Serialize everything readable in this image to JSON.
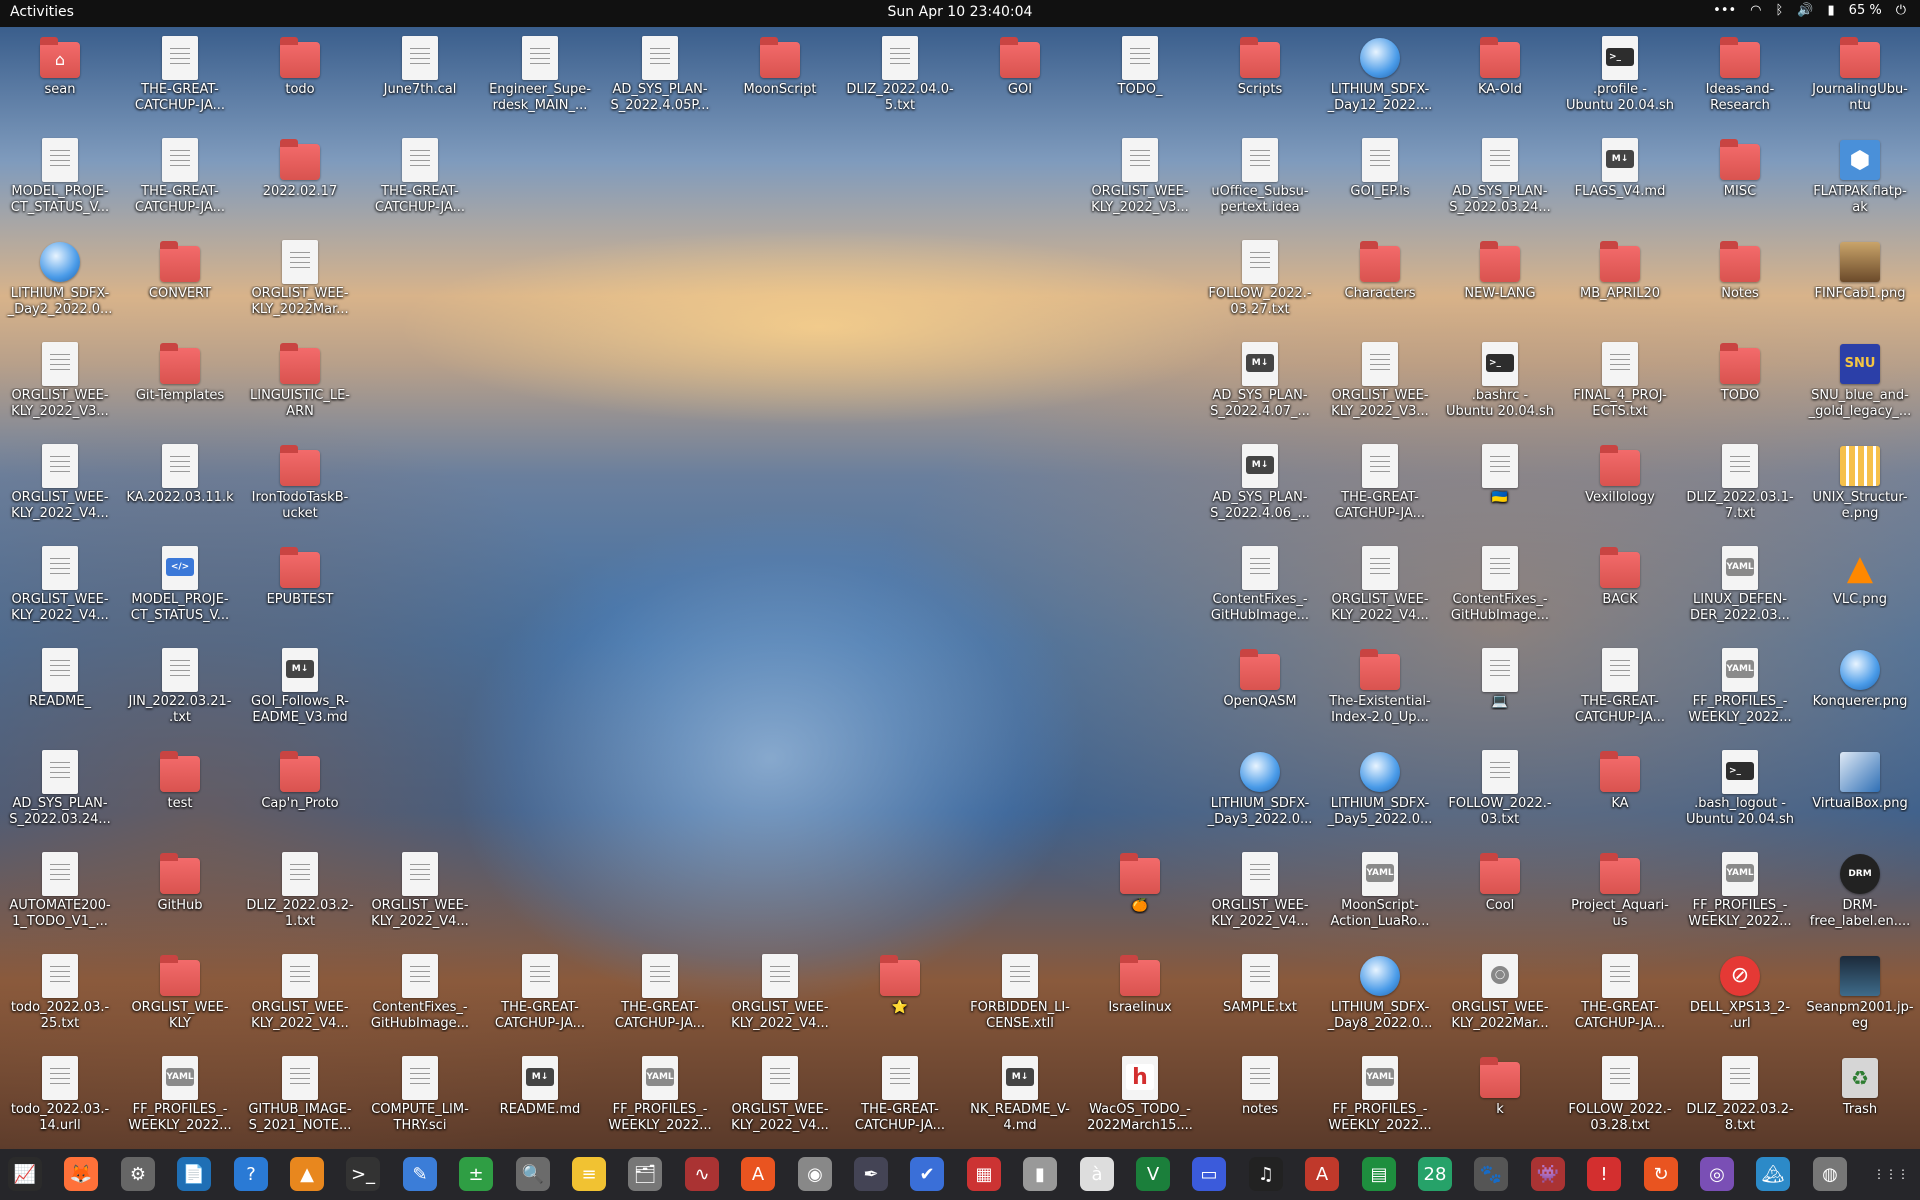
{
  "topbar": {
    "activities": "Activities",
    "clock": "Sun Apr 10  23:40:04",
    "battery": "65 %",
    "tray_icons": [
      "overflow-icon",
      "wifi-icon",
      "bluetooth-icon",
      "volume-icon",
      "battery-icon",
      "power-icon"
    ]
  },
  "desktop": {
    "icons": [
      {
        "label": "sean",
        "type": "home"
      },
      {
        "label": "THE-GREAT-\nCATCHUP-JA...",
        "type": "doc"
      },
      {
        "label": "todo",
        "type": "folder"
      },
      {
        "label": "June7th.cal",
        "type": "doc"
      },
      {
        "label": "Engineer_Supe-\nrdesk_MAIN_...",
        "type": "doc"
      },
      {
        "label": "AD_SYS_PLAN-\nS_2022.4.05P...",
        "type": "doc"
      },
      {
        "label": "MoonScript",
        "type": "folder"
      },
      {
        "label": "DLIZ_2022.04.0-\n5.txt",
        "type": "doc"
      },
      {
        "label": "GOI",
        "type": "folder"
      },
      {
        "label": "TODO_",
        "type": "doc"
      },
      {
        "label": "Scripts",
        "type": "folder"
      },
      {
        "label": "LITHIUM_SDFX-\n_Day12_2022....",
        "type": "orb"
      },
      {
        "label": "KA-Old",
        "type": "folder"
      },
      {
        "label": ".profile -\nUbuntu 20.04.sh",
        "type": "sh"
      },
      {
        "label": "Ideas-and-\nResearch",
        "type": "folder"
      },
      {
        "label": "JournalingUbu-\nntu",
        "type": "folder"
      },
      {
        "label": "MODEL_PROJE-\nCT_STATUS_V...",
        "type": "doc"
      },
      {
        "label": "THE-GREAT-\nCATCHUP-JA...",
        "type": "doc"
      },
      {
        "label": "2022.02.17",
        "type": "folder"
      },
      {
        "label": "THE-GREAT-\nCATCHUP-JA...",
        "type": "doc"
      },
      {
        "label": "ORGLIST_WEE-\nKLY_2022_V3...",
        "type": "doc"
      },
      {
        "label": "uOffice_Subsu-\npertext.idea",
        "type": "doc"
      },
      {
        "label": "GOI_EP.ls",
        "type": "doc"
      },
      {
        "label": "AD_SYS_PLAN-\nS_2022.03.24...",
        "type": "doc"
      },
      {
        "label": "FLAGS_V4.md",
        "type": "md"
      },
      {
        "label": "MISC",
        "type": "folder"
      },
      {
        "label": "FLATPAK.flatp-\nak",
        "type": "flatpak"
      },
      {
        "label": "LITHIUM_SDFX-\n_Day2_2022.0...",
        "type": "orb"
      },
      {
        "label": "CONVERT",
        "type": "folder"
      },
      {
        "label": "ORGLIST_WEE-\nKLY_2022Mar...",
        "type": "doc"
      },
      {
        "label": "FOLLOW_2022.-\n03.27.txt",
        "type": "doc"
      },
      {
        "label": "Characters",
        "type": "folder"
      },
      {
        "label": "NEW-LANG",
        "type": "folder"
      },
      {
        "label": "MB_APRIL20",
        "type": "folder"
      },
      {
        "label": "Notes",
        "type": "folder"
      },
      {
        "label": "FINFCab1.png",
        "type": "pic-cab"
      },
      {
        "label": "ORGLIST_WEE-\nKLY_2022_V3...",
        "type": "doc"
      },
      {
        "label": "Git-Templates",
        "type": "folder"
      },
      {
        "label": "LINGUISTIC_LE-\nARN",
        "type": "folder"
      },
      {
        "label": "AD_SYS_PLAN-\nS_2022.4.07_...",
        "type": "md"
      },
      {
        "label": "ORGLIST_WEE-\nKLY_2022_V3...",
        "type": "doc"
      },
      {
        "label": ".bashrc -\nUbuntu 20.04.sh",
        "type": "sh"
      },
      {
        "label": "FINAL_4_PROJ-\nECTS.txt",
        "type": "doc"
      },
      {
        "label": "TODO",
        "type": "folder"
      },
      {
        "label": "SNU_blue_and-\n_gold_legacy_...",
        "type": "pic-snu"
      },
      {
        "label": "ORGLIST_WEE-\nKLY_2022_V4...",
        "type": "doc"
      },
      {
        "label": "KA.2022.03.11.k",
        "type": "doc"
      },
      {
        "label": "IronTodoTaskB-\nucket",
        "type": "folder"
      },
      {
        "label": "AD_SYS_PLAN-\nS_2022.4.06_...",
        "type": "md"
      },
      {
        "label": "THE-GREAT-\nCATCHUP-JA...",
        "type": "doc"
      },
      {
        "label": "🇺🇦",
        "type": "doc"
      },
      {
        "label": "Vexillology",
        "type": "folder"
      },
      {
        "label": "DLIZ_2022.03.1-\n7.txt",
        "type": "doc"
      },
      {
        "label": "UNIX_Structur-\ne.png",
        "type": "pic-unix"
      },
      {
        "label": "ORGLIST_WEE-\nKLY_2022_V4...",
        "type": "doc"
      },
      {
        "label": "MODEL_PROJE-\nCT_STATUS_V...",
        "type": "code"
      },
      {
        "label": "EPUBTEST",
        "type": "folder"
      },
      {
        "label": "ContentFixes_-\nGitHubImage...",
        "type": "doc"
      },
      {
        "label": "ORGLIST_WEE-\nKLY_2022_V4...",
        "type": "doc"
      },
      {
        "label": "ContentFixes_-\nGitHubImage...",
        "type": "doc"
      },
      {
        "label": "BACK",
        "type": "folder"
      },
      {
        "label": "LINUX_DEFEN-\nDER_2022.03...",
        "type": "yaml"
      },
      {
        "label": "VLC.png",
        "type": "pic-vlc"
      },
      {
        "label": "README_",
        "type": "doc"
      },
      {
        "label": "JIN_2022.03.21-\n.txt",
        "type": "doc"
      },
      {
        "label": "GOI_Follows_R-\nEADME_V3.md",
        "type": "md"
      },
      {
        "label": "OpenQASM",
        "type": "folder"
      },
      {
        "label": "The-Existential-\nIndex-2.0_Up...",
        "type": "folder"
      },
      {
        "label": "💻",
        "type": "doc"
      },
      {
        "label": "THE-GREAT-\nCATCHUP-JA...",
        "type": "doc"
      },
      {
        "label": "FF_PROFILES_-\nWEEKLY_2022...",
        "type": "yaml"
      },
      {
        "label": "Konquerer.png",
        "type": "orb"
      },
      {
        "label": "AD_SYS_PLAN-\nS_2022.03.24...",
        "type": "doc"
      },
      {
        "label": "test",
        "type": "folder"
      },
      {
        "label": "Cap'n_Proto",
        "type": "folder"
      },
      {
        "label": "LITHIUM_SDFX-\n_Day3_2022.0...",
        "type": "orb"
      },
      {
        "label": "LITHIUM_SDFX-\n_Day5_2022.0...",
        "type": "orb"
      },
      {
        "label": "FOLLOW_2022.-\n03.txt",
        "type": "doc"
      },
      {
        "label": "KA",
        "type": "folder"
      },
      {
        "label": ".bash_logout -\nUbuntu 20.04.sh",
        "type": "sh"
      },
      {
        "label": "VirtualBox.png",
        "type": "pic-vbox"
      },
      {
        "label": "AUTOMATE200-\n1_TODO_V1_...",
        "type": "doc"
      },
      {
        "label": "GitHub",
        "type": "folder"
      },
      {
        "label": "DLIZ_2022.03.2-\n1.txt",
        "type": "doc"
      },
      {
        "label": "ORGLIST_WEE-\nKLY_2022_V4...",
        "type": "doc"
      },
      {
        "label": "🍊",
        "type": "folder"
      },
      {
        "label": "ORGLIST_WEE-\nKLY_2022_V4...",
        "type": "doc"
      },
      {
        "label": "MoonScript-\nAction_LuaRo...",
        "type": "yaml"
      },
      {
        "label": "Cool",
        "type": "folder"
      },
      {
        "label": "Project_Aquari-\nus",
        "type": "folder"
      },
      {
        "label": "FF_PROFILES_-\nWEEKLY_2022...",
        "type": "yaml"
      },
      {
        "label": "DRM-\nfree_label.en....",
        "type": "pic-drm"
      },
      {
        "label": "todo_2022.03.-\n25.txt",
        "type": "doc"
      },
      {
        "label": "ORGLIST_WEE-\nKLY",
        "type": "folder"
      },
      {
        "label": "ORGLIST_WEE-\nKLY_2022_V4...",
        "type": "doc"
      },
      {
        "label": "ContentFixes_-\nGitHubImage...",
        "type": "doc"
      },
      {
        "label": "THE-GREAT-\nCATCHUP-JA...",
        "type": "doc"
      },
      {
        "label": "THE-GREAT-\nCATCHUP-JA...",
        "type": "doc"
      },
      {
        "label": "ORGLIST_WEE-\nKLY_2022_V4...",
        "type": "doc"
      },
      {
        "label": "⭐",
        "type": "folder"
      },
      {
        "label": "FORBIDDEN_LI-\nCENSE.xtll",
        "type": "doc"
      },
      {
        "label": "Israelinux",
        "type": "folder"
      },
      {
        "label": "SAMPLE.txt",
        "type": "doc"
      },
      {
        "label": "LITHIUM_SDFX-\n_Day8_2022.0...",
        "type": "orb"
      },
      {
        "label": "ORGLIST_WEE-\nKLY_2022Mar...",
        "type": "ring"
      },
      {
        "label": "THE-GREAT-\nCATCHUP-JA...",
        "type": "doc"
      },
      {
        "label": "DELL_XPS13_2-\n.url",
        "type": "red"
      },
      {
        "label": "Seanpm2001.jp-\neg",
        "type": "pic-photo"
      },
      {
        "label": "todo_2022.03.-\n14.urll",
        "type": "doc"
      },
      {
        "label": "FF_PROFILES_-\nWEEKLY_2022...",
        "type": "yaml"
      },
      {
        "label": "GITHUB_IMAGE-\nS_2021_NOTE...",
        "type": "doc"
      },
      {
        "label": "COMPUTE_LIM-\nTHRY.sci",
        "type": "doc"
      },
      {
        "label": "README.md",
        "type": "md"
      },
      {
        "label": "FF_PROFILES_-\nWEEKLY_2022...",
        "type": "yaml"
      },
      {
        "label": "ORGLIST_WEE-\nKLY_2022_V4...",
        "type": "doc"
      },
      {
        "label": "THE-GREAT-\nCATCHUP-JA...",
        "type": "doc"
      },
      {
        "label": "NK_README_V-\n4.md",
        "type": "md"
      },
      {
        "label": "WacOS_TODO_-\n2022March15....",
        "type": "h"
      },
      {
        "label": "notes",
        "type": "doc"
      },
      {
        "label": "FF_PROFILES_-\nWEEKLY_2022...",
        "type": "yaml"
      },
      {
        "label": "k",
        "type": "folder"
      },
      {
        "label": "FOLLOW_2022.-\n03.28.txt",
        "type": "doc"
      },
      {
        "label": "DLIZ_2022.03.2-\n8.txt",
        "type": "doc"
      },
      {
        "label": "Trash",
        "type": "trash"
      }
    ]
  },
  "dock": {
    "items": [
      {
        "name": "system-monitor-icon",
        "glyph": "📈",
        "bg": "#2b2b2b"
      },
      {
        "name": "firefox-icon",
        "glyph": "🦊",
        "bg": "#ff7139"
      },
      {
        "name": "settings-icon",
        "glyph": "⚙",
        "bg": "#666"
      },
      {
        "name": "libreoffice-icon",
        "glyph": "📄",
        "bg": "#1f6fb5"
      },
      {
        "name": "help-icon",
        "glyph": "?",
        "bg": "#2a7ad5"
      },
      {
        "name": "vlc-icon",
        "glyph": "▲",
        "bg": "#e8871e"
      },
      {
        "name": "terminal-icon",
        "glyph": ">_",
        "bg": "#333"
      },
      {
        "name": "text-editor-icon",
        "glyph": "✎",
        "bg": "#3b7dd8"
      },
      {
        "name": "calculator-icon",
        "glyph": "±",
        "bg": "#2f9e44"
      },
      {
        "name": "image-viewer-icon",
        "glyph": "🔍",
        "bg": "#6b6b6b"
      },
      {
        "name": "notes-icon",
        "glyph": "≡",
        "bg": "#f1c232"
      },
      {
        "name": "files-icon",
        "glyph": "🗂",
        "bg": "#777"
      },
      {
        "name": "monitor-graph-icon",
        "glyph": "∿",
        "bg": "#a33"
      },
      {
        "name": "software-store-icon",
        "glyph": "A",
        "bg": "#e95420"
      },
      {
        "name": "disks-icon",
        "glyph": "◉",
        "bg": "#888"
      },
      {
        "name": "inkscape-icon",
        "glyph": "✒",
        "bg": "#445"
      },
      {
        "name": "todo-icon",
        "glyph": "✔",
        "bg": "#3a6fd8"
      },
      {
        "name": "document-scanner-icon",
        "glyph": "▦",
        "bg": "#c33"
      },
      {
        "name": "archive-icon",
        "glyph": "▮",
        "bg": "#999"
      },
      {
        "name": "character-map-icon",
        "glyph": "à",
        "bg": "#ddd"
      },
      {
        "name": "vim-icon",
        "glyph": "V",
        "bg": "#1b7f3b"
      },
      {
        "name": "screen-icon",
        "glyph": "▭",
        "bg": "#3b5bdb"
      },
      {
        "name": "music-icon",
        "glyph": "♫",
        "bg": "#222"
      },
      {
        "name": "pdf-icon",
        "glyph": "A",
        "bg": "#c0392b"
      },
      {
        "name": "spreadsheet-icon",
        "glyph": "▤",
        "bg": "#1e8e3e"
      },
      {
        "name": "calendar-icon",
        "glyph": "28",
        "bg": "#26a269"
      },
      {
        "name": "animal-icon",
        "glyph": "🐾",
        "bg": "#555"
      },
      {
        "name": "game-icon",
        "glyph": "👾",
        "bg": "#a33"
      },
      {
        "name": "alert-icon",
        "glyph": "!",
        "bg": "#d32f2f"
      },
      {
        "name": "updater-icon",
        "glyph": "↻",
        "bg": "#e95420"
      },
      {
        "name": "screenshot-icon",
        "glyph": "◎",
        "bg": "#7a4fb5"
      },
      {
        "name": "photo-icon",
        "glyph": "🏔",
        "bg": "#2c8ac8"
      },
      {
        "name": "ubuntu-icon",
        "glyph": "◍",
        "bg": "#777"
      },
      {
        "name": "app-grid-icon",
        "glyph": "⋮⋮⋮",
        "bg": "transparent"
      }
    ]
  }
}
